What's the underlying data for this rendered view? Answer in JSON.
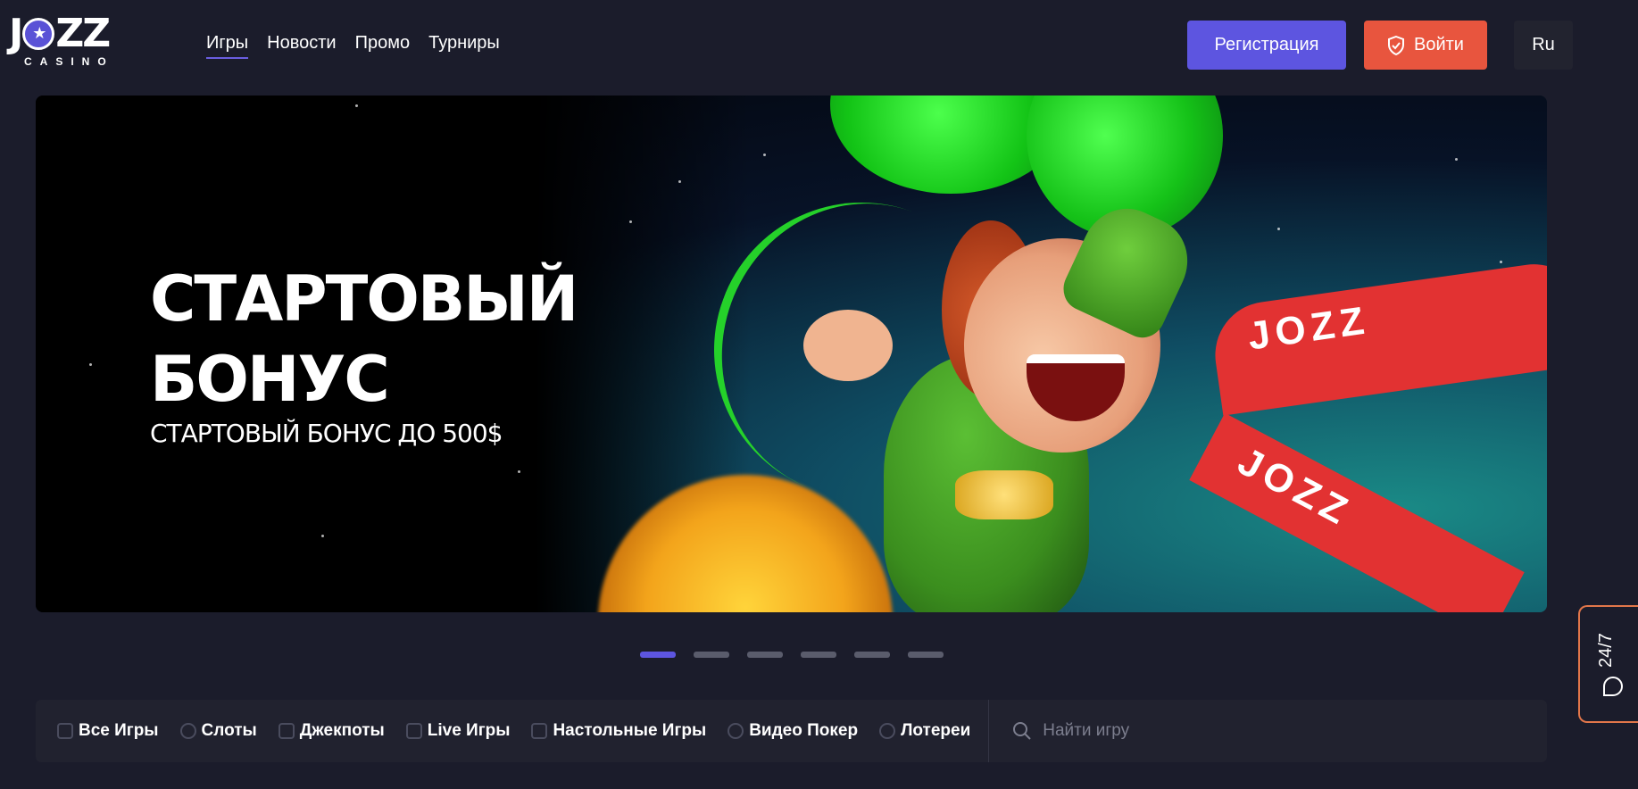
{
  "header": {
    "logo_main": "JOZZ",
    "logo_sub": "CASINO",
    "nav": [
      {
        "label": "Игры",
        "active": true
      },
      {
        "label": "Новости",
        "active": false
      },
      {
        "label": "Промо",
        "active": false
      },
      {
        "label": "Турниры",
        "active": false
      }
    ],
    "register_label": "Регистрация",
    "login_label": "Войти",
    "lang_label": "Ru"
  },
  "banner": {
    "title_line1": "СТАРТОВЫЙ",
    "title_line2": "БОНУС",
    "subtitle": "СТАРТОВЫЙ БОНУС ДО 500$",
    "ribbon_text": "JOZZ",
    "slides_total": 6,
    "active_slide": 1
  },
  "categories": [
    {
      "label": "Все Игры",
      "icon": "all-games-icon"
    },
    {
      "label": "Слоты",
      "icon": "cherries-icon"
    },
    {
      "label": "Джекпоты",
      "icon": "jackpot-icon"
    },
    {
      "label": "Live Игры",
      "icon": "live-tv-icon"
    },
    {
      "label": "Настольные Игры",
      "icon": "table-games-icon"
    },
    {
      "label": "Видео Покер",
      "icon": "poker-chip-icon"
    },
    {
      "label": "Лотереи",
      "icon": "lottery-ball-icon"
    }
  ],
  "search": {
    "placeholder": "Найти игру"
  },
  "support": {
    "label": "24/7"
  },
  "colors": {
    "background": "#1b1c2b",
    "accent": "#5d55e0",
    "login": "#e8553e",
    "support_border": "#e2764a"
  }
}
